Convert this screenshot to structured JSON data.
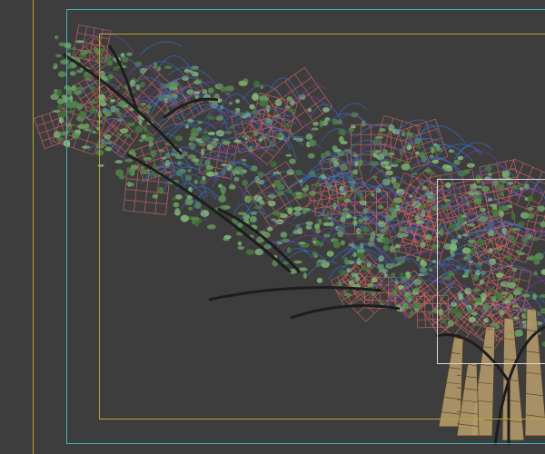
{
  "viewport": {
    "colors": {
      "background": "#3d3d3d",
      "safe_frame_outer": "#3fb3b3",
      "safe_frame_inner": "#b8a432",
      "region_frame": "#d8d8d8",
      "foliage": "#5f8a55",
      "wire_blue": "#3a6fd0",
      "wire_purple": "#7a3aa8",
      "wire_red": "#e06a6a",
      "trunk": "#b39a6a"
    }
  }
}
